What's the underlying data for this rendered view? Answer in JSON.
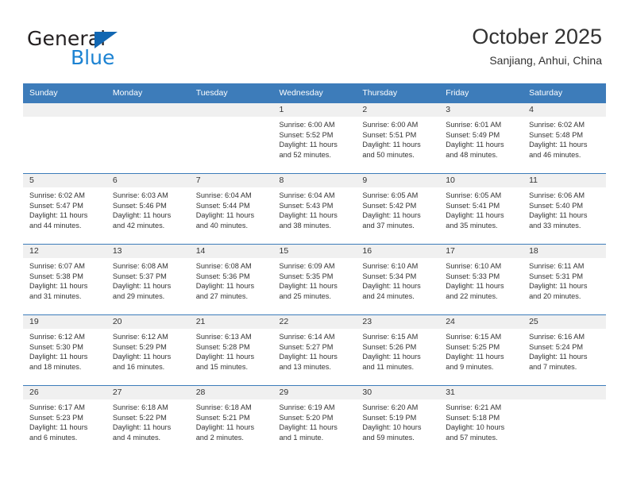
{
  "brand": {
    "name_part1": "General",
    "name_part2": "Blue",
    "triangle_color": "#1267b2",
    "blue_color": "#1b82d2"
  },
  "header": {
    "title": "October 2025",
    "subtitle": "Sanjiang, Anhui, China"
  },
  "theme": {
    "header_bg": "#3d7cba",
    "daynum_bg": "#f0f0f0",
    "text": "#333333"
  },
  "weekdays": [
    "Sunday",
    "Monday",
    "Tuesday",
    "Wednesday",
    "Thursday",
    "Friday",
    "Saturday"
  ],
  "labels": {
    "sunrise_prefix": "Sunrise: ",
    "sunset_prefix": "Sunset: ",
    "daylight_prefix": "Daylight: "
  },
  "weeks": [
    [
      {
        "day": "",
        "empty": true
      },
      {
        "day": "",
        "empty": true
      },
      {
        "day": "",
        "empty": true
      },
      {
        "day": "1",
        "sunrise": "Sunrise: 6:00 AM",
        "sunset": "Sunset: 5:52 PM",
        "daylight": "Daylight: 11 hours and 52 minutes."
      },
      {
        "day": "2",
        "sunrise": "Sunrise: 6:00 AM",
        "sunset": "Sunset: 5:51 PM",
        "daylight": "Daylight: 11 hours and 50 minutes."
      },
      {
        "day": "3",
        "sunrise": "Sunrise: 6:01 AM",
        "sunset": "Sunset: 5:49 PM",
        "daylight": "Daylight: 11 hours and 48 minutes."
      },
      {
        "day": "4",
        "sunrise": "Sunrise: 6:02 AM",
        "sunset": "Sunset: 5:48 PM",
        "daylight": "Daylight: 11 hours and 46 minutes."
      }
    ],
    [
      {
        "day": "5",
        "sunrise": "Sunrise: 6:02 AM",
        "sunset": "Sunset: 5:47 PM",
        "daylight": "Daylight: 11 hours and 44 minutes."
      },
      {
        "day": "6",
        "sunrise": "Sunrise: 6:03 AM",
        "sunset": "Sunset: 5:46 PM",
        "daylight": "Daylight: 11 hours and 42 minutes."
      },
      {
        "day": "7",
        "sunrise": "Sunrise: 6:04 AM",
        "sunset": "Sunset: 5:44 PM",
        "daylight": "Daylight: 11 hours and 40 minutes."
      },
      {
        "day": "8",
        "sunrise": "Sunrise: 6:04 AM",
        "sunset": "Sunset: 5:43 PM",
        "daylight": "Daylight: 11 hours and 38 minutes."
      },
      {
        "day": "9",
        "sunrise": "Sunrise: 6:05 AM",
        "sunset": "Sunset: 5:42 PM",
        "daylight": "Daylight: 11 hours and 37 minutes."
      },
      {
        "day": "10",
        "sunrise": "Sunrise: 6:05 AM",
        "sunset": "Sunset: 5:41 PM",
        "daylight": "Daylight: 11 hours and 35 minutes."
      },
      {
        "day": "11",
        "sunrise": "Sunrise: 6:06 AM",
        "sunset": "Sunset: 5:40 PM",
        "daylight": "Daylight: 11 hours and 33 minutes."
      }
    ],
    [
      {
        "day": "12",
        "sunrise": "Sunrise: 6:07 AM",
        "sunset": "Sunset: 5:38 PM",
        "daylight": "Daylight: 11 hours and 31 minutes."
      },
      {
        "day": "13",
        "sunrise": "Sunrise: 6:08 AM",
        "sunset": "Sunset: 5:37 PM",
        "daylight": "Daylight: 11 hours and 29 minutes."
      },
      {
        "day": "14",
        "sunrise": "Sunrise: 6:08 AM",
        "sunset": "Sunset: 5:36 PM",
        "daylight": "Daylight: 11 hours and 27 minutes."
      },
      {
        "day": "15",
        "sunrise": "Sunrise: 6:09 AM",
        "sunset": "Sunset: 5:35 PM",
        "daylight": "Daylight: 11 hours and 25 minutes."
      },
      {
        "day": "16",
        "sunrise": "Sunrise: 6:10 AM",
        "sunset": "Sunset: 5:34 PM",
        "daylight": "Daylight: 11 hours and 24 minutes."
      },
      {
        "day": "17",
        "sunrise": "Sunrise: 6:10 AM",
        "sunset": "Sunset: 5:33 PM",
        "daylight": "Daylight: 11 hours and 22 minutes."
      },
      {
        "day": "18",
        "sunrise": "Sunrise: 6:11 AM",
        "sunset": "Sunset: 5:31 PM",
        "daylight": "Daylight: 11 hours and 20 minutes."
      }
    ],
    [
      {
        "day": "19",
        "sunrise": "Sunrise: 6:12 AM",
        "sunset": "Sunset: 5:30 PM",
        "daylight": "Daylight: 11 hours and 18 minutes."
      },
      {
        "day": "20",
        "sunrise": "Sunrise: 6:12 AM",
        "sunset": "Sunset: 5:29 PM",
        "daylight": "Daylight: 11 hours and 16 minutes."
      },
      {
        "day": "21",
        "sunrise": "Sunrise: 6:13 AM",
        "sunset": "Sunset: 5:28 PM",
        "daylight": "Daylight: 11 hours and 15 minutes."
      },
      {
        "day": "22",
        "sunrise": "Sunrise: 6:14 AM",
        "sunset": "Sunset: 5:27 PM",
        "daylight": "Daylight: 11 hours and 13 minutes."
      },
      {
        "day": "23",
        "sunrise": "Sunrise: 6:15 AM",
        "sunset": "Sunset: 5:26 PM",
        "daylight": "Daylight: 11 hours and 11 minutes."
      },
      {
        "day": "24",
        "sunrise": "Sunrise: 6:15 AM",
        "sunset": "Sunset: 5:25 PM",
        "daylight": "Daylight: 11 hours and 9 minutes."
      },
      {
        "day": "25",
        "sunrise": "Sunrise: 6:16 AM",
        "sunset": "Sunset: 5:24 PM",
        "daylight": "Daylight: 11 hours and 7 minutes."
      }
    ],
    [
      {
        "day": "26",
        "sunrise": "Sunrise: 6:17 AM",
        "sunset": "Sunset: 5:23 PM",
        "daylight": "Daylight: 11 hours and 6 minutes."
      },
      {
        "day": "27",
        "sunrise": "Sunrise: 6:18 AM",
        "sunset": "Sunset: 5:22 PM",
        "daylight": "Daylight: 11 hours and 4 minutes."
      },
      {
        "day": "28",
        "sunrise": "Sunrise: 6:18 AM",
        "sunset": "Sunset: 5:21 PM",
        "daylight": "Daylight: 11 hours and 2 minutes."
      },
      {
        "day": "29",
        "sunrise": "Sunrise: 6:19 AM",
        "sunset": "Sunset: 5:20 PM",
        "daylight": "Daylight: 11 hours and 1 minute."
      },
      {
        "day": "30",
        "sunrise": "Sunrise: 6:20 AM",
        "sunset": "Sunset: 5:19 PM",
        "daylight": "Daylight: 10 hours and 59 minutes."
      },
      {
        "day": "31",
        "sunrise": "Sunrise: 6:21 AM",
        "sunset": "Sunset: 5:18 PM",
        "daylight": "Daylight: 10 hours and 57 minutes."
      },
      {
        "day": "",
        "empty": true
      }
    ]
  ]
}
